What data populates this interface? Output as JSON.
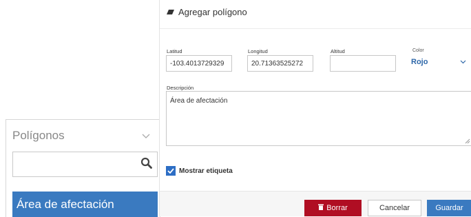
{
  "polygons_panel": {
    "header_label": "Polígonos",
    "search_placeholder": "",
    "items": [
      "Área de afectación"
    ]
  },
  "form": {
    "title": "Agregar polígono",
    "latitude": {
      "label": "Latitud",
      "value": "-103.4013729329"
    },
    "longitude": {
      "label": "Longitud",
      "value": "20.71363525272"
    },
    "altitude": {
      "label": "Altitud",
      "value": ""
    },
    "color": {
      "label": "Color",
      "value": "Rojo"
    },
    "description": {
      "label": "Descripción",
      "value": "Área de afectación"
    },
    "show_label": {
      "label": "Mostrar etiqueta",
      "checked": true
    },
    "buttons": {
      "delete": "Borrar",
      "cancel": "Cancelar",
      "save": "Guardar"
    }
  },
  "colors": {
    "accent": "#3a7ac0",
    "danger": "#b00e23",
    "link": "#2c66a8"
  }
}
